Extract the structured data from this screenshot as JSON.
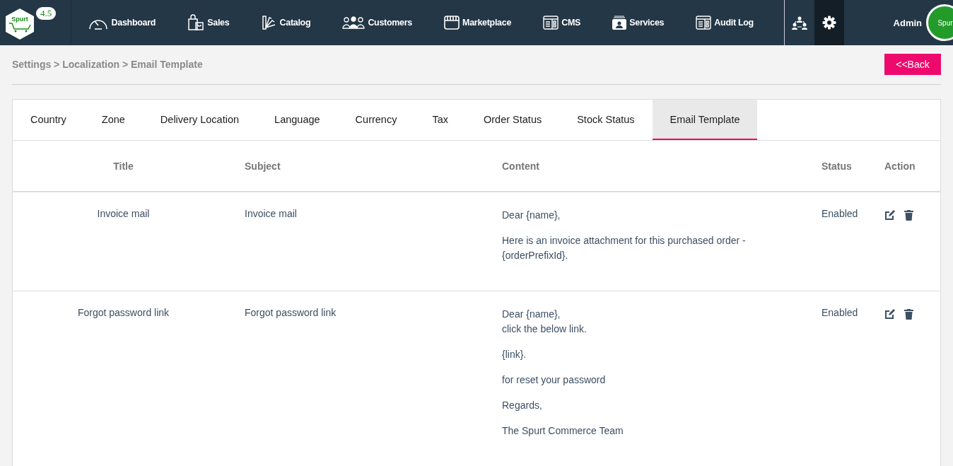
{
  "header": {
    "logo_text": "Spurt",
    "version": "4.5",
    "nav": [
      {
        "label": "Dashboard"
      },
      {
        "label": "Sales"
      },
      {
        "label": "Catalog"
      },
      {
        "label": "Customers"
      },
      {
        "label": "Marketplace"
      },
      {
        "label": "CMS"
      },
      {
        "label": "Services"
      },
      {
        "label": "Audit Log"
      }
    ],
    "user": "Admin",
    "avatar_text": "Spur"
  },
  "breadcrumb": "Settings > Localization > Email Template",
  "back_button": "<<Back",
  "tabs": [
    {
      "label": "Country",
      "selected": false
    },
    {
      "label": "Zone",
      "selected": false
    },
    {
      "label": "Delivery Location",
      "selected": false
    },
    {
      "label": "Language",
      "selected": false
    },
    {
      "label": "Currency",
      "selected": false
    },
    {
      "label": "Tax",
      "selected": false
    },
    {
      "label": "Order Status",
      "selected": false
    },
    {
      "label": "Stock Status",
      "selected": false
    },
    {
      "label": "Email Template",
      "selected": true
    }
  ],
  "table": {
    "columns": [
      "Title",
      "Subject",
      "Content",
      "Status",
      "Action"
    ],
    "rows": [
      {
        "title": "Invoice mail",
        "subject": "Invoice mail",
        "content": [
          "Dear {name},",
          "Here is an invoice attachment for this purchased order - {orderPrefixId}."
        ],
        "status": "Enabled"
      },
      {
        "title": "Forgot password link",
        "subject": "Forgot password link",
        "content": [
          "Dear {name},\nclick the below link.",
          "{link}.",
          "for reset your password",
          "Regards,",
          "The Spurt Commerce Team"
        ],
        "status": "Enabled"
      }
    ]
  }
}
